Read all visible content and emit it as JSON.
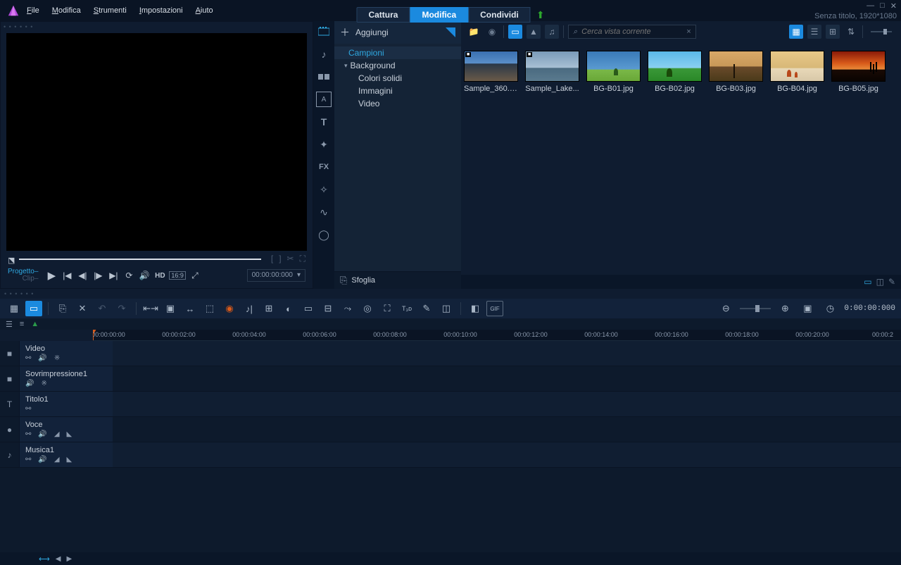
{
  "menu": {
    "items": [
      "File",
      "Modifica",
      "Strumenti",
      "Impostazioni",
      "Aiuto"
    ]
  },
  "modes": {
    "capture": "Cattura",
    "edit": "Modifica",
    "share": "Condividi"
  },
  "header": {
    "title": "Senza titolo, 1920*1080"
  },
  "preview": {
    "project_label": "Progetto",
    "clip_label": "Clip",
    "hd_label": "HD",
    "aspect_label": "16:9",
    "timecode": "00:00:00:000"
  },
  "library": {
    "add_label": "Aggiungi",
    "browse_label": "Sfoglia",
    "tree": {
      "samples": "Campioni",
      "background": "Background",
      "colors": "Colori solidi",
      "images": "Immagini",
      "video": "Video"
    },
    "search_placeholder": "Cerca vista corrente",
    "thumbs": [
      {
        "label": "Sample_360.m..."
      },
      {
        "label": "Sample_Lake..."
      },
      {
        "label": "BG-B01.jpg"
      },
      {
        "label": "BG-B02.jpg"
      },
      {
        "label": "BG-B03.jpg"
      },
      {
        "label": "BG-B04.jpg"
      },
      {
        "label": "BG-B05.jpg"
      }
    ]
  },
  "timeline": {
    "timecode": "0:00:00:000",
    "ruler": [
      "00:00:00:00",
      "00:00:02:00",
      "00:00:04:00",
      "00:00:06:00",
      "00:00:08:00",
      "00:00:10:00",
      "00:00:12:00",
      "00:00:14:00",
      "00:00:16:00",
      "00:00:18:00",
      "00:00:20:00",
      "00:00:2"
    ],
    "tracks": {
      "video": "Video",
      "overlay": "Sovrimpressione1",
      "title": "Titolo1",
      "voice": "Voce",
      "music": "Musica1"
    }
  }
}
